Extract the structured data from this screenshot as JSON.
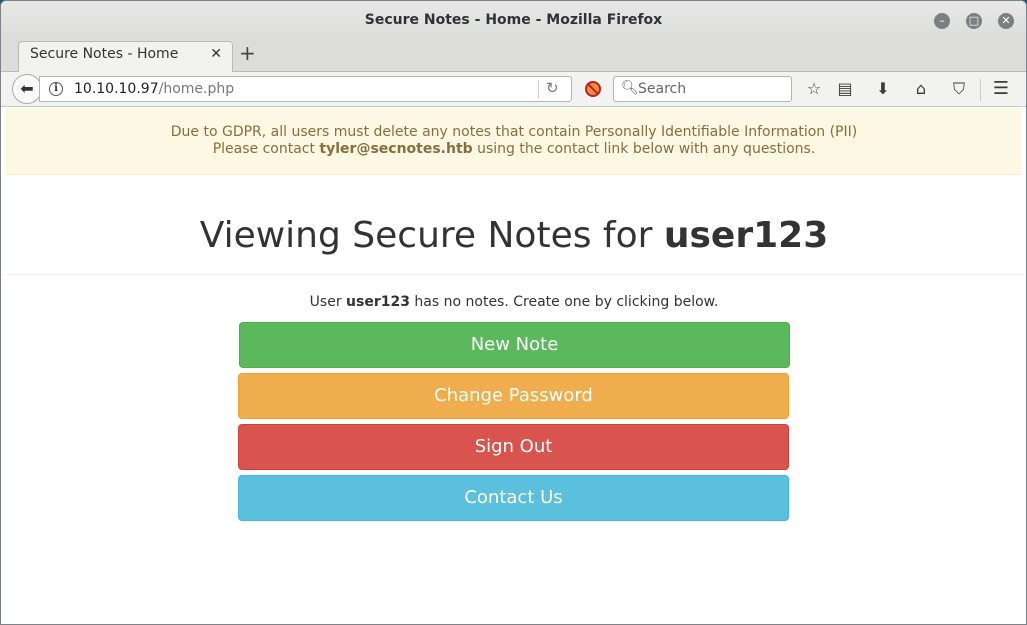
{
  "window": {
    "title": "Secure Notes - Home - Mozilla Firefox"
  },
  "tabs": [
    {
      "label": "Secure Notes - Home",
      "active": true
    }
  ],
  "navbar": {
    "url_host": "10.10.10.97",
    "url_path": "/home.php",
    "search_placeholder": "Search"
  },
  "page": {
    "alert": {
      "line1": "Due to GDPR, all users must delete any notes that contain Personally Identifiable Information (PII)",
      "line2_prefix": "Please contact ",
      "contact_email": "tyler@secnotes.htb",
      "line2_suffix": " using the contact link below with any questions."
    },
    "heading_prefix": "Viewing Secure Notes for ",
    "username": "user123",
    "no_notes": {
      "prefix": "User ",
      "username": "user123",
      "suffix": " has no notes. Create one by clicking below."
    },
    "buttons": {
      "new_note": "New Note",
      "change_password": "Change Password",
      "sign_out": "Sign Out",
      "contact_us": "Contact Us"
    }
  },
  "colors": {
    "success": "#5cb85c",
    "warning": "#f0ad4e",
    "danger": "#d9534f",
    "info": "#5bc0de",
    "alert_bg": "#fcf8e3",
    "alert_text": "#8a6d3b"
  }
}
